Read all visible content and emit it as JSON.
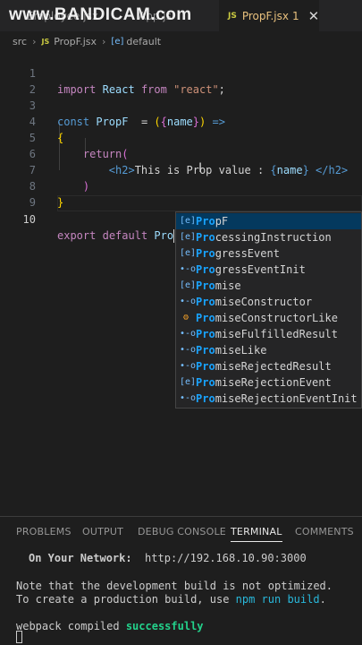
{
  "watermark": {
    "text": "www.BANDICAM.com"
  },
  "tabs": [
    {
      "label": "Employee.jsx"
    },
    {
      "label": "App.js"
    },
    {
      "label": "PropF.jsx",
      "badge": "1",
      "js": "JS"
    }
  ],
  "breadcrumb": {
    "folder": "src",
    "file": "PropF.jsx",
    "symbol": "default",
    "js": "JS"
  },
  "editor": {
    "line_numbers": [
      "1",
      "2",
      "3",
      "4",
      "5",
      "6",
      "7",
      "8",
      "9",
      "10"
    ],
    "lines": {
      "l1": {
        "kw1": "import",
        "id": "React",
        "kw2": "from",
        "str": "\"react\"",
        "end": ";"
      },
      "l3": {
        "kw": "const",
        "id": "PropF",
        "op": "=",
        "open": "(",
        "brace_open": "{",
        "param": "name",
        "brace_close": "}",
        "close": ")",
        "arrow": "=>"
      },
      "l4": {
        "text": "{"
      },
      "l5": {
        "kw": "return",
        "paren": "("
      },
      "l6": {
        "tag_open": "<h2>",
        "text": "This is Prop value : ",
        "expr_open": "{",
        "expr": "name",
        "expr_close": "}",
        "tag_close": "</h2>"
      },
      "l7": {
        "text": ")"
      },
      "l8": {
        "text": "}"
      },
      "l10": {
        "kw1": "export",
        "kw2": "default",
        "typed": "Pro"
      }
    }
  },
  "suggestions": [
    {
      "match": "Pro",
      "rest": "pF",
      "icon": "[e]"
    },
    {
      "match": "Pro",
      "rest": "cessingInstruction",
      "icon": "[e]"
    },
    {
      "match": "Pro",
      "rest": "gressEvent",
      "icon": "[e]"
    },
    {
      "match": "Pro",
      "rest": "gressEventInit",
      "icon": "•-o"
    },
    {
      "match": "Pro",
      "rest": "mise",
      "icon": "[e]"
    },
    {
      "match": "Pro",
      "rest": "miseConstructor",
      "icon": "•-o"
    },
    {
      "match": "Pro",
      "rest": "miseConstructorLike",
      "icon": "⚙"
    },
    {
      "match": "Pro",
      "rest": "miseFulfilledResult",
      "icon": "•-o"
    },
    {
      "match": "Pro",
      "rest": "miseLike",
      "icon": "•-o"
    },
    {
      "match": "Pro",
      "rest": "miseRejectedResult",
      "icon": "•-o"
    },
    {
      "match": "Pro",
      "rest": "miseRejectionEvent",
      "icon": "[e]"
    },
    {
      "match": "Pro",
      "rest": "miseRejectionEventInit",
      "icon": "•-o"
    }
  ],
  "panel": {
    "tabs": [
      "PROBLEMS",
      "OUTPUT",
      "DEBUG CONSOLE",
      "TERMINAL",
      "COMMENTS"
    ],
    "active_tab": "TERMINAL",
    "terminal": {
      "network_label": "On Your Network:",
      "network_url": "http://192.168.10.90:3000",
      "note1": "Note that the development build is not optimized.",
      "note2_pre": "To create a production build, use ",
      "note2_cmd": "npm run build",
      "note2_post": ".",
      "compiled_pre": "webpack compiled ",
      "compiled_ok": "successfully"
    }
  }
}
